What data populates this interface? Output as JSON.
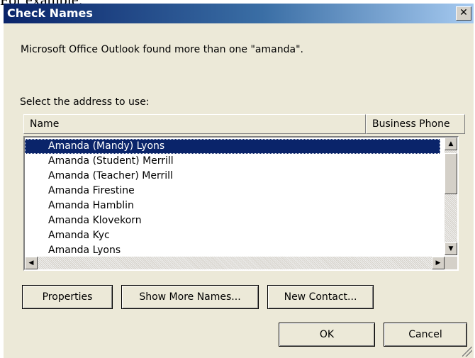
{
  "context": {
    "text": "For example:"
  },
  "dialog": {
    "title": "Check Names",
    "close_glyph": "✕",
    "message": "Microsoft Office Outlook found more than one \"amanda\".",
    "select_label": "Select the address to use:"
  },
  "list": {
    "columns": [
      "Name",
      "Business Phone"
    ],
    "items": [
      "Amanda (Mandy) Lyons",
      "Amanda (Student) Merrill",
      "Amanda (Teacher) Merrill",
      "Amanda Firestine",
      "Amanda Hamblin",
      "Amanda Klovekorn",
      "Amanda Kyc",
      "Amanda Lyons"
    ],
    "selected_index": 0
  },
  "scroll_glyphs": {
    "up": "▲",
    "down": "▼",
    "left": "◀",
    "right": "▶"
  },
  "buttons": {
    "properties": "Properties",
    "show_more": "Show More Names...",
    "new_contact": "New Contact...",
    "ok": "OK",
    "cancel": "Cancel"
  }
}
